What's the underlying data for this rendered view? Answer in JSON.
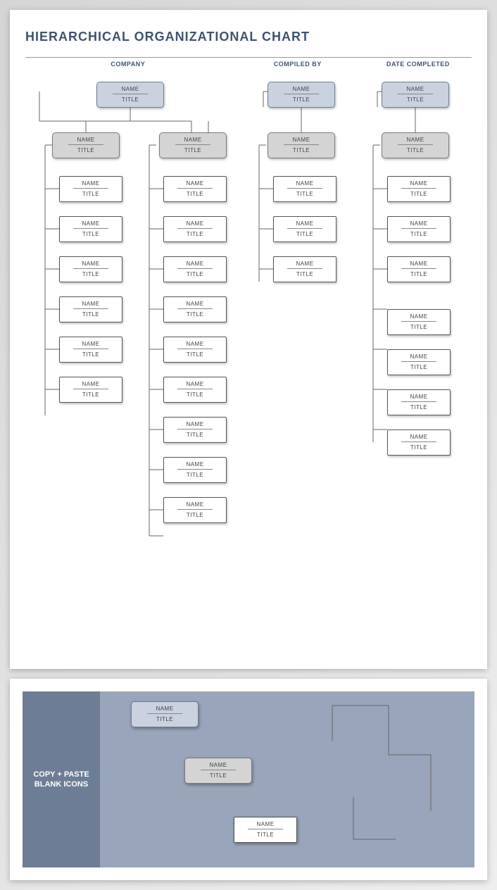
{
  "title": "HIERARCHICAL ORGANIZATIONAL CHART",
  "headers": {
    "company": "COMPANY",
    "compiled": "COMPILED BY",
    "date": "DATE COMPLETED"
  },
  "node": {
    "name": "NAME",
    "title": "TITLE"
  },
  "palette_label": "COPY + PASTE BLANK ICONS",
  "columns": {
    "tree1": {
      "top": 1,
      "managers": [
        {
          "children": 6
        },
        {
          "children": 9
        }
      ]
    },
    "tree2": {
      "top": 1,
      "managers": [
        {
          "children": 3
        }
      ]
    },
    "tree3": {
      "top": 1,
      "managers": [
        {
          "children": 7
        }
      ]
    }
  }
}
